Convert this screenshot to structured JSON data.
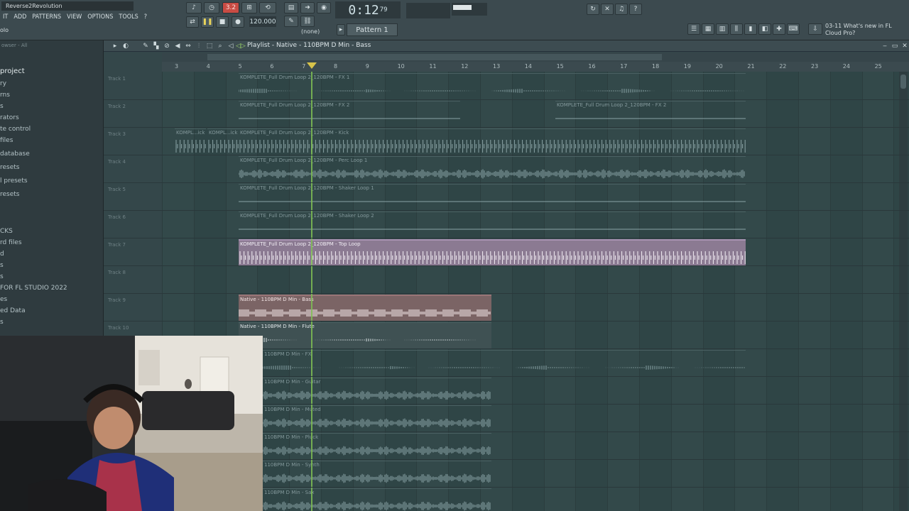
{
  "app": {
    "project_name": "Reverse2Revolution",
    "menus": [
      "IT",
      "ADD",
      "PATTERNS",
      "VIEW",
      "OPTIONS",
      "TOOLS",
      "?"
    ],
    "hint": "olo",
    "record_count": "3.2",
    "tempo": "120.000",
    "time": "0:12",
    "time_sub": "79",
    "time_unit": "M:S:CS",
    "snap": "(none)",
    "pattern": "Pattern 1",
    "news_date": "03-11",
    "news_text": "What's new in FL Cloud Pro?"
  },
  "browser": {
    "header": "owser - All",
    "items": [
      {
        "label": "project",
        "strong": true
      },
      {
        "label": "ry"
      },
      {
        "label": "rns"
      },
      {
        "label": "s"
      },
      {
        "label": "rators"
      },
      {
        "label": "te control"
      },
      {
        "label": "files"
      },
      {
        "label": "database"
      },
      {
        "label": "resets"
      },
      {
        "label": "l presets"
      },
      {
        "label": "resets"
      },
      {
        "label": "CKS"
      },
      {
        "label": "rd files"
      },
      {
        "label": "d"
      },
      {
        "label": "s"
      },
      {
        "label": "s"
      },
      {
        "label": "FOR FL STUDIO 2022"
      },
      {
        "label": "es"
      },
      {
        "label": "ed Data"
      },
      {
        "label": "s"
      }
    ]
  },
  "playlist": {
    "title": "Playlist - Native - 110BPM D Min - Bass",
    "bar_numbers": [
      "3",
      "4",
      "5",
      "6",
      "7",
      "8",
      "9",
      "10",
      "11",
      "12",
      "13",
      "14",
      "15",
      "16",
      "17",
      "18",
      "19",
      "20",
      "21",
      "22",
      "23",
      "24",
      "25"
    ],
    "track_names": [
      "Track 1",
      "Track 2",
      "Track 3",
      "Track 4",
      "Track 5",
      "Track 6",
      "Track 7",
      "Track 8",
      "Track 9",
      "Track 10"
    ],
    "clips": [
      {
        "label": "KOMPLETE_Full Drum Loop 2_120BPM - FX 1"
      },
      {
        "label": "KOMPLETE_Full Drum Loop 2_120BPM - FX 2"
      },
      {
        "label": "KOMPLETE_Full Drum Loop 2_120BPM - FX 2"
      },
      {
        "label": "KOMPL...ick"
      },
      {
        "label": "KOMPL...ick"
      },
      {
        "label": "KOMPLETE_Full Drum Loop 2_120BPM - Kick"
      },
      {
        "label": "KOMPLETE_Full Drum Loop 2_120BPM - Perc Loop 1"
      },
      {
        "label": "KOMPLETE_Full Drum Loop 2_120BPM - Shaker Loop 1"
      },
      {
        "label": "KOMPLETE_Full Drum Loop 2_120BPM - Shaker Loop 2"
      },
      {
        "label": "KOMPLETE_Full Drum Loop 2_120BPM - Top Loop"
      },
      {
        "label": "Native - 110BPM D Min - Bass"
      },
      {
        "label": "Native - 110BPM D Min - Flute"
      },
      {
        "label": "110BPM D Min - FX"
      },
      {
        "label": "110BPM D Min - Guitar"
      },
      {
        "label": "110BPM D Min - Muted"
      },
      {
        "label": "110BPM D Min - Pluck"
      },
      {
        "label": "110BPM D Min - Synth"
      },
      {
        "label": "110BPM D Min - Sax"
      }
    ]
  },
  "colors": {
    "grid": "#33494a",
    "playhead": "#7fbf54",
    "clip_selected": "#8b7a92",
    "clip_red": "#7b6465"
  }
}
